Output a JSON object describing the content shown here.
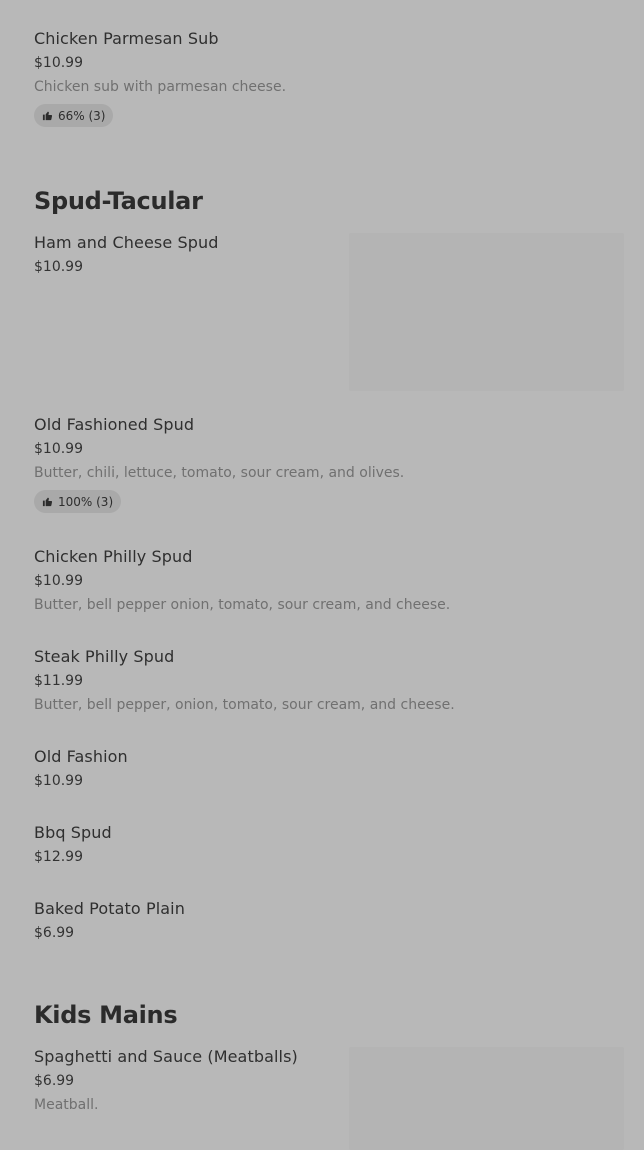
{
  "colors": {
    "background": "#b8b8b8",
    "image_placeholder": "#b4b4b4",
    "rating_badge": "#a9a9a9",
    "description_text": "#707070"
  },
  "sections": [
    {
      "items": [
        {
          "name": "Chicken Parmesan Sub",
          "price": "$10.99",
          "description": "Chicken sub with parmesan cheese.",
          "rating": "66% (3)",
          "rating_icon": "thumbs-up-icon"
        }
      ]
    },
    {
      "title": "Spud-Tacular",
      "items": [
        {
          "name": "Ham and Cheese Spud",
          "price": "$10.99"
        },
        {
          "name": "Old Fashioned Spud",
          "price": "$10.99",
          "description": "Butter, chili, lettuce, tomato, sour cream, and olives.",
          "rating": "100% (3)",
          "rating_icon": "thumbs-up-icon"
        },
        {
          "name": "Chicken Philly Spud",
          "price": "$10.99",
          "description": "Butter, bell pepper onion, tomato, sour cream, and cheese."
        },
        {
          "name": "Steak Philly Spud",
          "price": "$11.99",
          "description": "Butter, bell pepper, onion, tomato, sour cream, and cheese."
        },
        {
          "name": "Old Fashion",
          "price": "$10.99"
        },
        {
          "name": "Bbq Spud",
          "price": "$12.99"
        },
        {
          "name": "Baked Potato Plain",
          "price": "$6.99"
        }
      ]
    },
    {
      "title": "Kids Mains",
      "items": [
        {
          "name": "Spaghetti and Sauce (Meatballs)",
          "price": "$6.99",
          "description": "Meatball."
        }
      ]
    }
  ]
}
